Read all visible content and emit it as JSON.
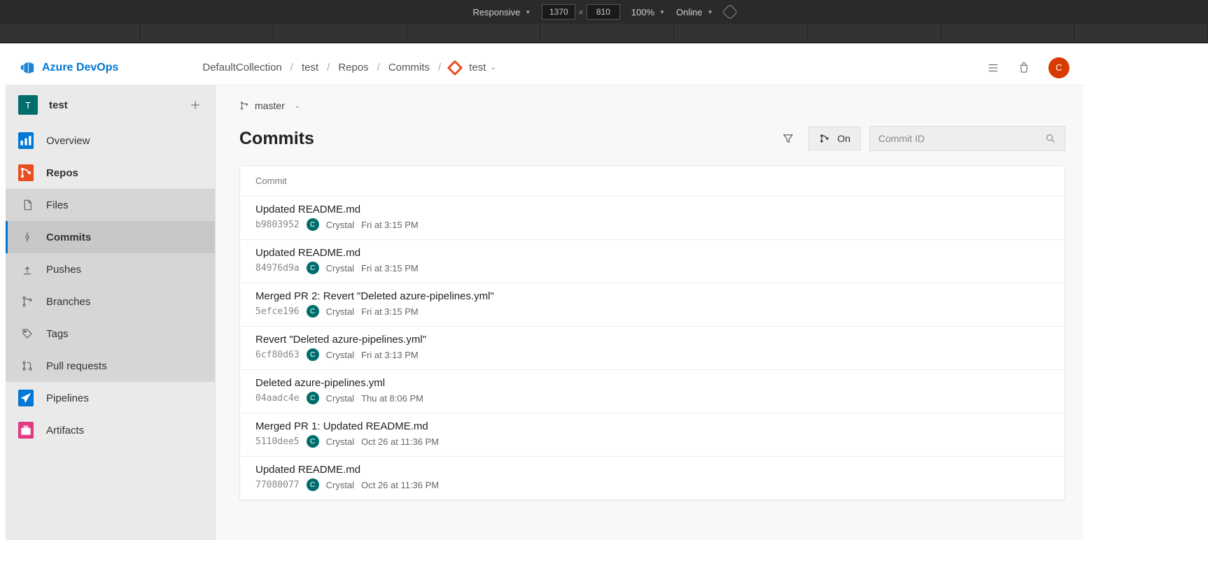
{
  "devtools": {
    "mode": "Responsive",
    "width": "1370",
    "height": "810",
    "zoom": "100%",
    "network": "Online"
  },
  "header": {
    "logo_text": "Azure DevOps",
    "breadcrumb": [
      "DefaultCollection",
      "test",
      "Repos",
      "Commits"
    ],
    "repo_name": "test",
    "avatar_letter": "C"
  },
  "sidebar": {
    "project_tile": "T",
    "project_name": "test",
    "items": {
      "overview": "Overview",
      "repos": "Repos",
      "pipelines": "Pipelines",
      "artifacts": "Artifacts"
    },
    "repos_sub": {
      "files": "Files",
      "commits": "Commits",
      "pushes": "Pushes",
      "branches": "Branches",
      "tags": "Tags",
      "pull_requests": "Pull requests"
    }
  },
  "main": {
    "branch": "master",
    "title": "Commits",
    "graph_toggle": "On",
    "search_placeholder": "Commit ID",
    "table_header": "Commit",
    "commits": [
      {
        "title": "Updated README.md",
        "hash": "b9803952",
        "author": "Crystal",
        "time": "Fri at 3:15 PM",
        "avatar": "C"
      },
      {
        "title": "Updated README.md",
        "hash": "84976d9a",
        "author": "Crystal",
        "time": "Fri at 3:15 PM",
        "avatar": "C"
      },
      {
        "title": "Merged PR 2: Revert \"Deleted azure-pipelines.yml\"",
        "hash": "5efce196",
        "author": "Crystal",
        "time": "Fri at 3:15 PM",
        "avatar": "C"
      },
      {
        "title": "Revert \"Deleted azure-pipelines.yml\"",
        "hash": "6cf80d63",
        "author": "Crystal",
        "time": "Fri at 3:13 PM",
        "avatar": "C"
      },
      {
        "title": "Deleted azure-pipelines.yml",
        "hash": "04aadc4e",
        "author": "Crystal",
        "time": "Thu at 8:06 PM",
        "avatar": "C"
      },
      {
        "title": "Merged PR 1: Updated README.md",
        "hash": "5110dee5",
        "author": "Crystal",
        "time": "Oct 26 at 11:36 PM",
        "avatar": "C"
      },
      {
        "title": "Updated README.md",
        "hash": "77080077",
        "author": "Crystal",
        "time": "Oct 26 at 11:36 PM",
        "avatar": "C"
      }
    ]
  }
}
